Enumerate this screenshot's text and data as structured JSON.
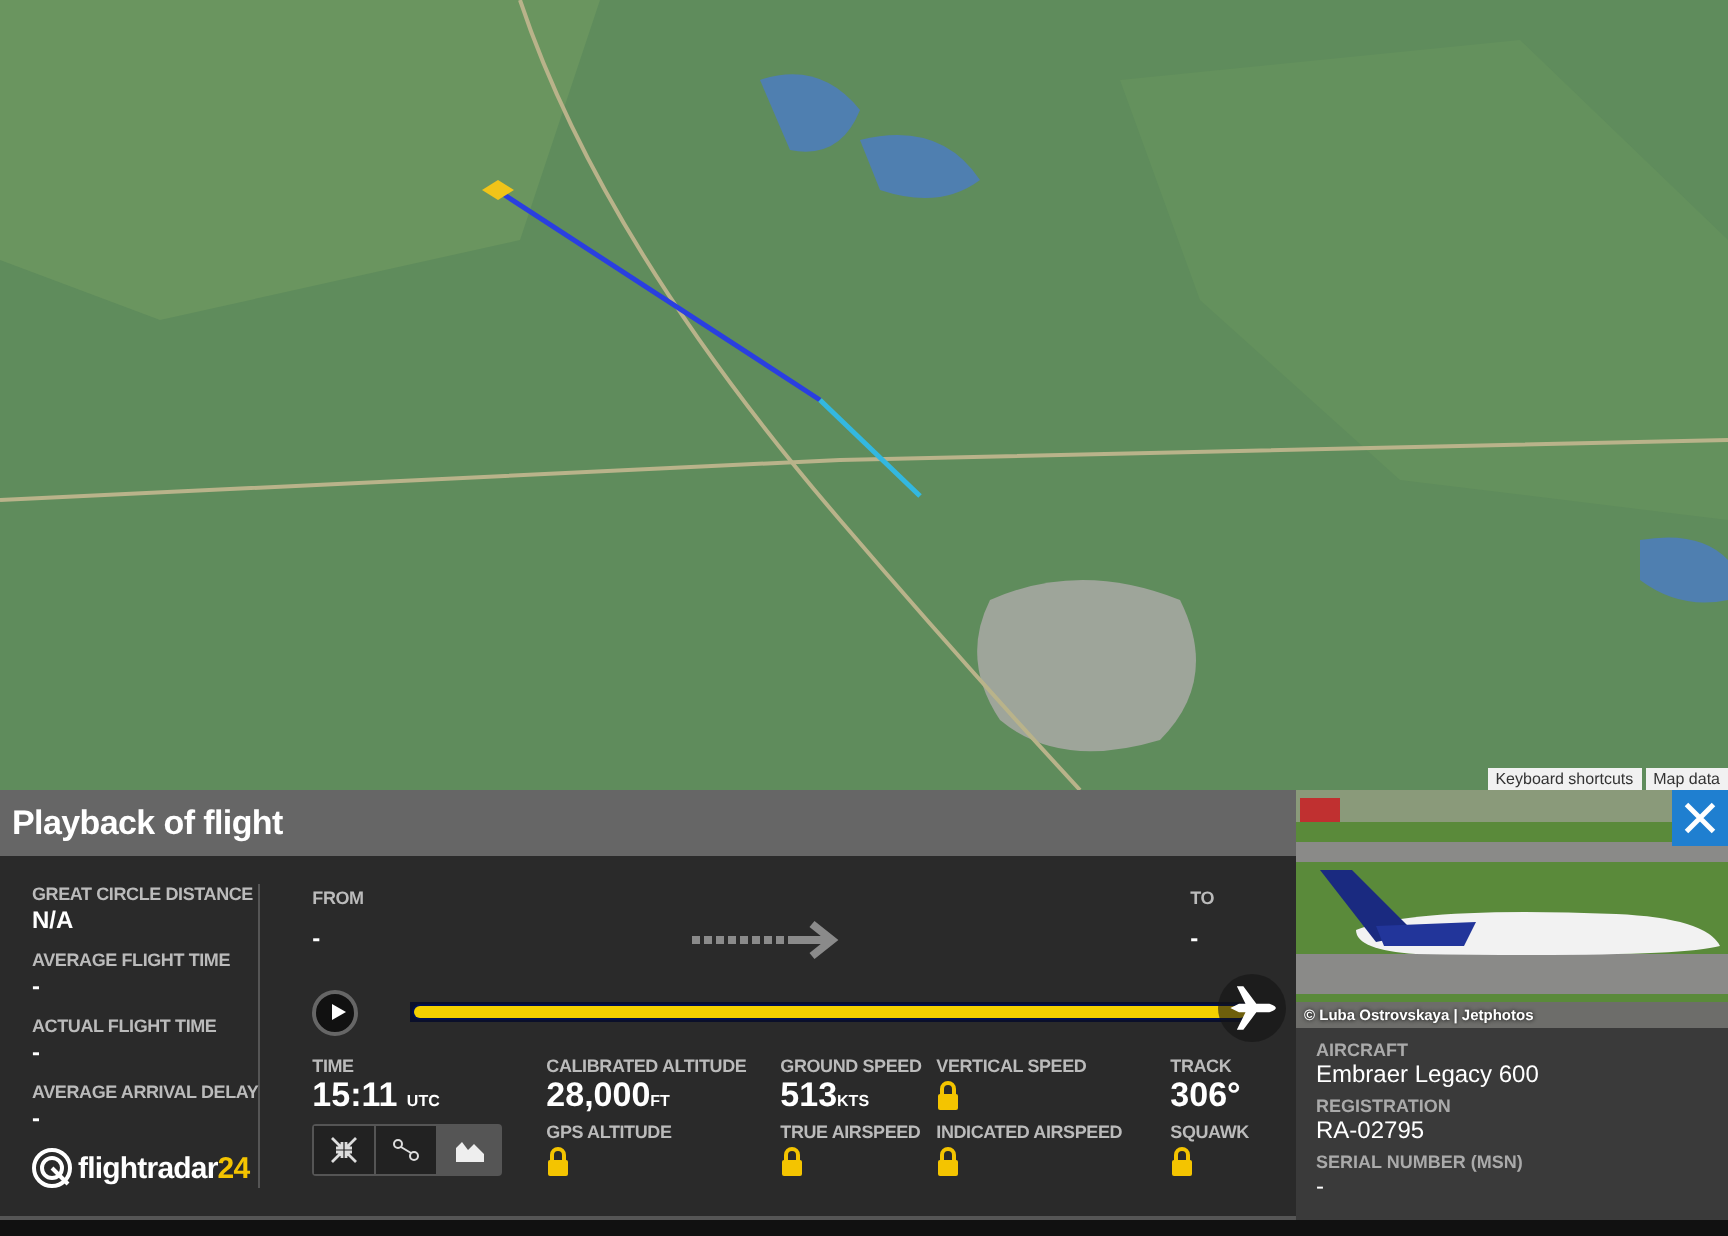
{
  "map": {
    "controls": [
      "Keyboard shortcuts",
      "Map data"
    ]
  },
  "panel": {
    "title": "Playback of flight"
  },
  "stats": [
    {
      "label": "GREAT CIRCLE DISTANCE",
      "value": "N/A"
    },
    {
      "label": "AVERAGE FLIGHT TIME",
      "value": "-"
    },
    {
      "label": "ACTUAL FLIGHT TIME",
      "value": "-"
    },
    {
      "label": "AVERAGE ARRIVAL DELAY",
      "value": "-"
    }
  ],
  "logo": {
    "name": "flightradar",
    "suffix": "24"
  },
  "route": {
    "from_label": "FROM",
    "from": "-",
    "to_label": "TO",
    "to": "-"
  },
  "playback": {
    "level": 1
  },
  "time": {
    "label": "TIME",
    "value": "15:11",
    "unit": "UTC"
  },
  "view_buttons": [
    {
      "kind": "collapse",
      "selected": false
    },
    {
      "kind": "route",
      "selected": false
    },
    {
      "kind": "chart",
      "selected": true
    }
  ],
  "readings": [
    {
      "items": [
        {
          "label": "CALIBRATED ALTITUDE",
          "value": "28,000",
          "unit": "FT",
          "locked": false
        },
        {
          "label": "GPS ALTITUDE",
          "locked": true
        }
      ]
    },
    {
      "items": [
        {
          "label": "GROUND SPEED",
          "value": "513",
          "unit": "KTS",
          "locked": false
        },
        {
          "label": "TRUE AIRSPEED",
          "locked": true
        }
      ]
    },
    {
      "items": [
        {
          "label": "VERTICAL SPEED",
          "locked": true
        },
        {
          "label": "INDICATED AIRSPEED",
          "locked": true
        }
      ]
    },
    {
      "items": [
        {
          "label": "TRACK",
          "value": "306°",
          "locked": false
        },
        {
          "label": "SQUAWK",
          "locked": true
        }
      ]
    }
  ],
  "aircraft": {
    "photo_credit": "© Luba Ostrovskaya | Jetphotos",
    "fields": [
      {
        "label": "AIRCRAFT",
        "value": "Embraer Legacy 600"
      },
      {
        "label": "REGISTRATION",
        "value": "RA-02795"
      },
      {
        "label": "SERIAL NUMBER (MSN)",
        "value": "-"
      }
    ]
  }
}
